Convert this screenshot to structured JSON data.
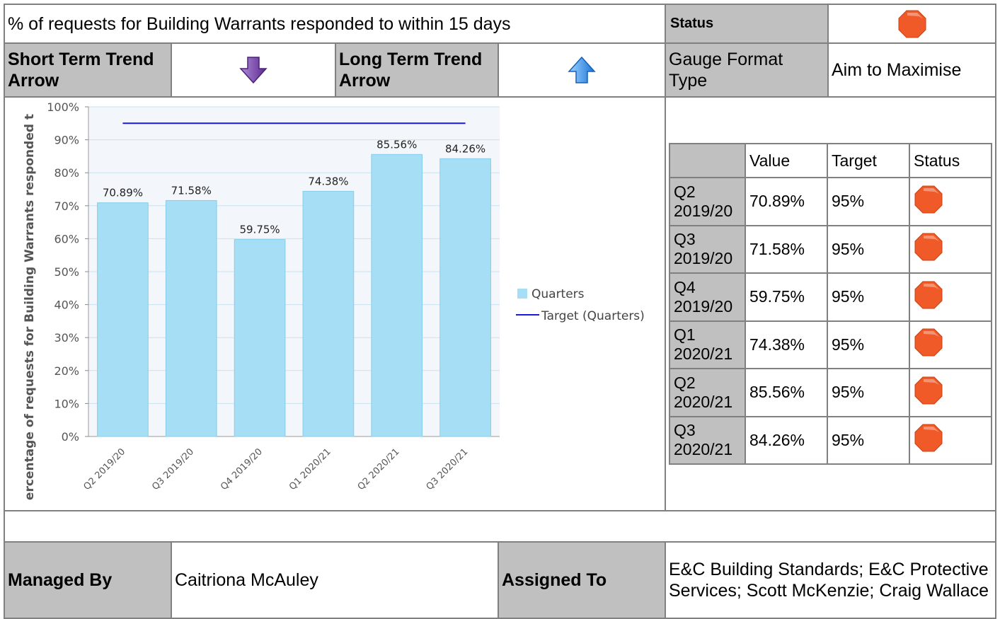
{
  "header": {
    "title": "% of requests for Building Warrants responded to within 15 days",
    "status_label": "Status",
    "status_color": "#f05a28"
  },
  "trend": {
    "short_label": "Short Term Trend Arrow",
    "short_icon": "down-arrow-icon",
    "long_label": "Long Term Trend Arrow",
    "long_icon": "up-arrow-icon",
    "gauge_label": "Gauge Format Type",
    "gauge_value": "Aim to Maximise"
  },
  "chart_data": {
    "type": "bar",
    "categories": [
      "Q2 2019/20",
      "Q3 2019/20",
      "Q4 2019/20",
      "Q1 2020/21",
      "Q2 2020/21",
      "Q3 2020/21"
    ],
    "series": [
      {
        "name": "Quarters",
        "type": "bar",
        "values": [
          70.89,
          71.58,
          59.75,
          74.38,
          85.56,
          84.26
        ],
        "color": "#a6dff5"
      },
      {
        "name": "Target (Quarters)",
        "type": "line",
        "values": [
          95,
          95,
          95,
          95,
          95,
          95
        ],
        "color": "#1a1adc"
      }
    ],
    "value_labels": [
      "70.89%",
      "71.58%",
      "59.75%",
      "74.38%",
      "85.56%",
      "84.26%"
    ],
    "yticks": [
      "0%",
      "10%",
      "20%",
      "30%",
      "40%",
      "50%",
      "60%",
      "70%",
      "80%",
      "90%",
      "100%"
    ],
    "ylim": [
      0,
      100
    ],
    "ylabel": "ercentage of requests for Building Warrants responded t",
    "xlabel": "",
    "legend_position": "right",
    "grid": true
  },
  "table": {
    "headers": [
      "",
      "Value",
      "Target",
      "Status"
    ],
    "rows": [
      {
        "period": "Q2 2019/20",
        "value": "70.89%",
        "target": "95%",
        "status": "red"
      },
      {
        "period": "Q3 2019/20",
        "value": "71.58%",
        "target": "95%",
        "status": "red"
      },
      {
        "period": "Q4 2019/20",
        "value": "59.75%",
        "target": "95%",
        "status": "red"
      },
      {
        "period": "Q1 2020/21",
        "value": "74.38%",
        "target": "95%",
        "status": "red"
      },
      {
        "period": "Q2 2020/21",
        "value": "85.56%",
        "target": "95%",
        "status": "red"
      },
      {
        "period": "Q3 2020/21",
        "value": "84.26%",
        "target": "95%",
        "status": "red"
      }
    ]
  },
  "footer": {
    "managed_label": "Managed By",
    "managed_value": "Caitriona McAuley",
    "assigned_label": "Assigned To",
    "assigned_value": "E&C Building Standards; E&C Protective Services; Scott McKenzie; Craig Wallace"
  },
  "icons": {
    "status_icon": "stop-octagon-icon"
  },
  "colors": {
    "label_bg": "#c0c0c0",
    "border": "#808080",
    "status_red": "#f05a28",
    "trend_down": "#7a44a8",
    "trend_up": "#2f8fe6"
  }
}
